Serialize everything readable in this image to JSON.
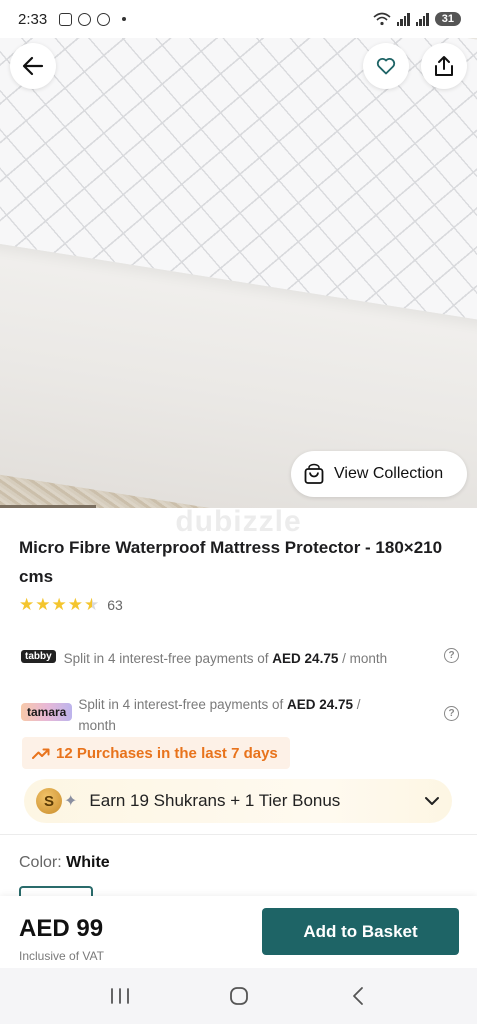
{
  "status_bar": {
    "time": "2:33",
    "battery": "31"
  },
  "hero": {
    "view_collection_label": "View Collection",
    "watermark": "dubizzle"
  },
  "product": {
    "title": "Micro Fibre Waterproof Mattress Protector - 180×210 cms",
    "rating_value": 4.5,
    "rating_count": "63"
  },
  "installments": {
    "tabby": {
      "logo": "tabby",
      "text": "Split in 4 interest-free payments of",
      "amount": "AED 24.75",
      "suffix": " / month"
    },
    "tamara": {
      "logo": "tamara",
      "text": "Split in 4 interest-free payments of",
      "amount": "AED 24.75",
      "suffix": " / month"
    }
  },
  "purchases_badge": "12 Purchases in the last 7 days",
  "shukran": {
    "coin_letter": "S",
    "label": "Earn 19 Shukrans + 1 Tier Bonus"
  },
  "color": {
    "key": "Color:",
    "value": "White"
  },
  "footer": {
    "price": "AED 99",
    "vat_note": "Inclusive of VAT",
    "add_to_basket": "Add to Basket"
  },
  "colors": {
    "primary": "#1e6466",
    "accent_orange": "#e8731c",
    "star": "#f4c52e"
  }
}
